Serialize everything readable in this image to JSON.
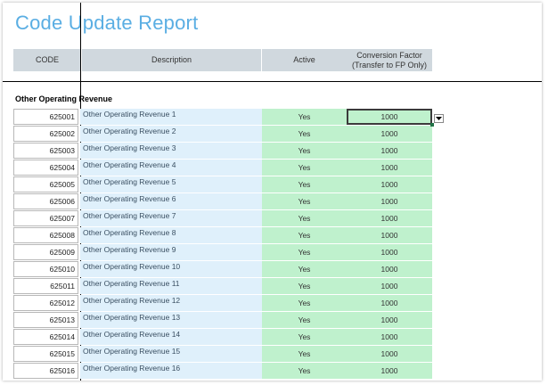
{
  "title": "Code Update Report",
  "headers": {
    "code": "CODE",
    "description": "Description",
    "active": "Active",
    "conversion_line1": "Conversion Factor",
    "conversion_line2": "(Transfer to FP Only)"
  },
  "section_title": "Other Operating Revenue",
  "rows": [
    {
      "code": "625001",
      "description": "Other Operating Revenue 1",
      "active": "Yes",
      "conversion": "1000"
    },
    {
      "code": "625002",
      "description": "Other Operating Revenue 2",
      "active": "Yes",
      "conversion": "1000"
    },
    {
      "code": "625003",
      "description": "Other Operating Revenue 3",
      "active": "Yes",
      "conversion": "1000"
    },
    {
      "code": "625004",
      "description": "Other Operating Revenue 4",
      "active": "Yes",
      "conversion": "1000"
    },
    {
      "code": "625005",
      "description": "Other Operating Revenue 5",
      "active": "Yes",
      "conversion": "1000"
    },
    {
      "code": "625006",
      "description": "Other Operating Revenue 6",
      "active": "Yes",
      "conversion": "1000"
    },
    {
      "code": "625007",
      "description": "Other Operating Revenue 7",
      "active": "Yes",
      "conversion": "1000"
    },
    {
      "code": "625008",
      "description": "Other Operating Revenue 8",
      "active": "Yes",
      "conversion": "1000"
    },
    {
      "code": "625009",
      "description": "Other Operating Revenue 9",
      "active": "Yes",
      "conversion": "1000"
    },
    {
      "code": "625010",
      "description": "Other Operating Revenue 10",
      "active": "Yes",
      "conversion": "1000"
    },
    {
      "code": "625011",
      "description": "Other Operating Revenue 11",
      "active": "Yes",
      "conversion": "1000"
    },
    {
      "code": "625012",
      "description": "Other Operating Revenue 12",
      "active": "Yes",
      "conversion": "1000"
    },
    {
      "code": "625013",
      "description": "Other Operating Revenue 13",
      "active": "Yes",
      "conversion": "1000"
    },
    {
      "code": "625014",
      "description": "Other Operating Revenue 14",
      "active": "Yes",
      "conversion": "1000"
    },
    {
      "code": "625015",
      "description": "Other Operating Revenue 15",
      "active": "Yes",
      "conversion": "1000"
    },
    {
      "code": "625016",
      "description": "Other Operating Revenue 16",
      "active": "Yes",
      "conversion": "1000"
    }
  ],
  "icons": {
    "dropdown": "chevron-down-icon"
  },
  "colors": {
    "title": "#5aaee3",
    "header_bg": "#d0d8de",
    "description_bg": "#dff0fb",
    "active_bg": "#bff1cd",
    "selection_border": "#3b3b3b"
  }
}
